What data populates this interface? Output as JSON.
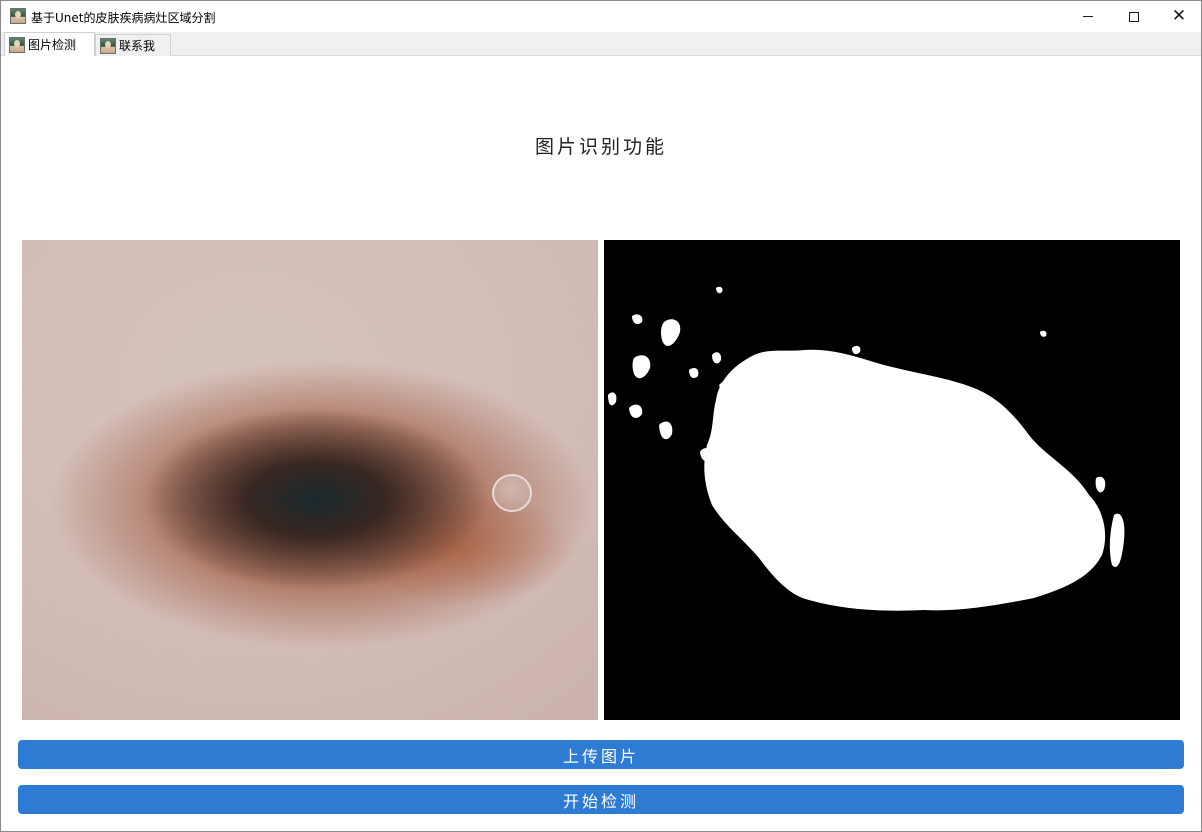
{
  "window": {
    "title": "基于Unet的皮肤疾病病灶区域分割",
    "app_icon": "app-portrait-icon"
  },
  "tabs": [
    {
      "label": "图片检测",
      "active": true,
      "icon": "portrait-icon"
    },
    {
      "label": "联系我",
      "active": false,
      "icon": "portrait-icon"
    }
  ],
  "main": {
    "heading": "图片识别功能",
    "original_image": {
      "description_icon": "skin-lesion-photo"
    },
    "mask_image": {
      "description_icon": "segmentation-mask"
    },
    "upload_button": "上传图片",
    "detect_button": "开始检测"
  },
  "colors": {
    "button_bg": "#2e7bd4",
    "button_text": "#ffffff",
    "mask_bg": "#000000",
    "mask_fg": "#ffffff"
  }
}
